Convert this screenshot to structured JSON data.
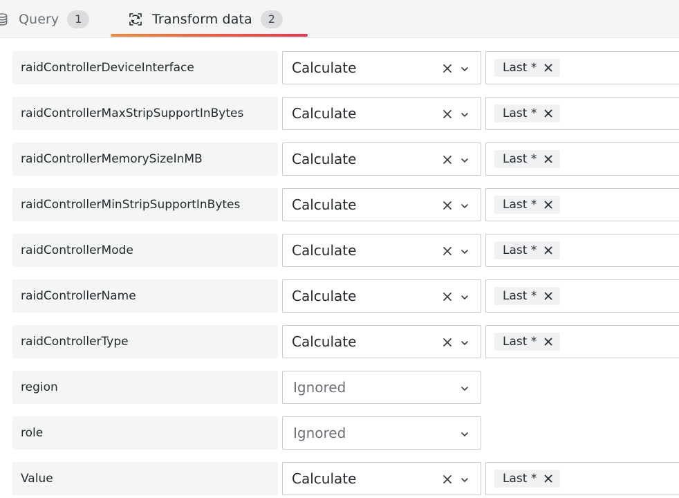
{
  "tabs": [
    {
      "label": "Query",
      "count": "1",
      "icon": "database-icon",
      "active": false
    },
    {
      "label": "Transform data",
      "count": "2",
      "icon": "transform-icon",
      "active": true
    }
  ],
  "colors": {
    "tab_underline_start": "#f0883e",
    "tab_underline_end": "#e5354e"
  },
  "fields": [
    {
      "name": "raidControllerDeviceInterface",
      "mode": "Calculate",
      "calculations": [
        "Last *"
      ]
    },
    {
      "name": "raidControllerMaxStripSupportInBytes",
      "mode": "Calculate",
      "calculations": [
        "Last *"
      ]
    },
    {
      "name": "raidControllerMemorySizeInMB",
      "mode": "Calculate",
      "calculations": [
        "Last *"
      ]
    },
    {
      "name": "raidControllerMinStripSupportInBytes",
      "mode": "Calculate",
      "calculations": [
        "Last *"
      ]
    },
    {
      "name": "raidControllerMode",
      "mode": "Calculate",
      "calculations": [
        "Last *"
      ]
    },
    {
      "name": "raidControllerName",
      "mode": "Calculate",
      "calculations": [
        "Last *"
      ]
    },
    {
      "name": "raidControllerType",
      "mode": "Calculate",
      "calculations": [
        "Last *"
      ]
    },
    {
      "name": "region",
      "mode": "Ignored",
      "calculations": []
    },
    {
      "name": "role",
      "mode": "Ignored",
      "calculations": []
    },
    {
      "name": "Value",
      "mode": "Calculate",
      "calculations": [
        "Last *"
      ]
    }
  ]
}
